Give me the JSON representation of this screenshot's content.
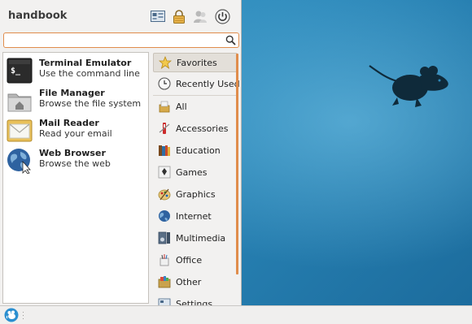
{
  "menu": {
    "username": "handbook",
    "header_buttons": [
      {
        "name": "settings-manager-icon"
      },
      {
        "name": "lock-screen-icon"
      },
      {
        "name": "switch-user-icon"
      },
      {
        "name": "log-out-icon"
      }
    ],
    "search": {
      "value": "",
      "placeholder": ""
    },
    "favorites": [
      {
        "title": "Terminal Emulator",
        "desc": "Use the command line",
        "icon": "terminal-icon"
      },
      {
        "title": "File Manager",
        "desc": "Browse the file system",
        "icon": "folder-icon"
      },
      {
        "title": "Mail Reader",
        "desc": "Read your email",
        "icon": "mail-icon"
      },
      {
        "title": "Web Browser",
        "desc": "Browse the web",
        "icon": "globe-icon"
      }
    ],
    "categories": [
      {
        "label": "Favorites",
        "icon": "star-icon"
      },
      {
        "label": "Recently Used",
        "icon": "clock-icon"
      },
      {
        "label": "All",
        "icon": "all-apps-icon"
      },
      {
        "label": "Accessories",
        "icon": "accessories-icon"
      },
      {
        "label": "Education",
        "icon": "education-icon"
      },
      {
        "label": "Games",
        "icon": "games-icon"
      },
      {
        "label": "Graphics",
        "icon": "graphics-icon"
      },
      {
        "label": "Internet",
        "icon": "internet-icon"
      },
      {
        "label": "Multimedia",
        "icon": "multimedia-icon"
      },
      {
        "label": "Office",
        "icon": "office-icon"
      },
      {
        "label": "Other",
        "icon": "other-icon"
      },
      {
        "label": "Settings",
        "icon": "settings-icon"
      }
    ],
    "selected_category": "Favorites"
  },
  "panel": {
    "menu_button_icon": "xfce-mouse-icon"
  },
  "colors": {
    "accent": "#e08d4c",
    "desktop": "#2d86b6"
  }
}
